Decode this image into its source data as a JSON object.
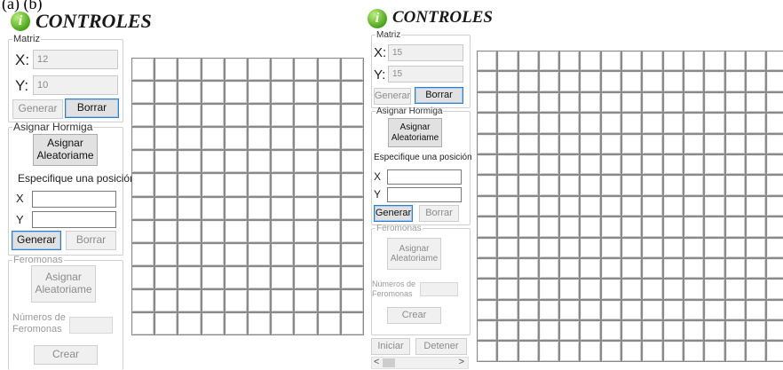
{
  "caption": "(a) (b)",
  "panels": [
    {
      "title": "CONTROLES",
      "matriz": {
        "legend": "Matriz",
        "x_label": "X:",
        "x_value": "12",
        "y_label": "Y:",
        "y_value": "10",
        "generar": "Generar",
        "borrar": "Borrar"
      },
      "hormiga": {
        "legend": "Asignar Hormiga",
        "random_btn": "Asignar\nAleatoriame",
        "spec_label": "Especifique una posición",
        "x_label": "X",
        "y_label": "Y",
        "generar": "Generar",
        "borrar": "Borrar"
      },
      "feromonas": {
        "legend": "Feromonas",
        "random_btn": "Asignar\nAleatoriame",
        "num_label": "Números de\nFeromonas",
        "crear": "Crear"
      },
      "grid": {
        "cols": 10,
        "rows": 12
      }
    },
    {
      "title": "CONTROLES",
      "matriz": {
        "legend": "Matriz",
        "x_label": "X:",
        "x_value": "15",
        "y_label": "Y:",
        "y_value": "15",
        "generar": "Generar",
        "borrar": "Borrar"
      },
      "hormiga": {
        "legend": "Asignar Hormiga",
        "random_btn": "Asignar\nAleatoriame",
        "spec_label": "Especifique una posición",
        "x_label": "X",
        "y_label": "Y",
        "generar": "Generar",
        "borrar": "Borrar"
      },
      "feromonas": {
        "legend": "Feromonas",
        "random_btn": "Asignar\nAleatoriame",
        "num_label": "Números de\nFeromonas",
        "crear": "Crear"
      },
      "bottom": {
        "iniciar": "Iniciar",
        "detener": "Detener"
      },
      "scroll": {
        "left": "<",
        "right": ">"
      },
      "grid": {
        "cols": 15,
        "rows": 15
      }
    }
  ]
}
